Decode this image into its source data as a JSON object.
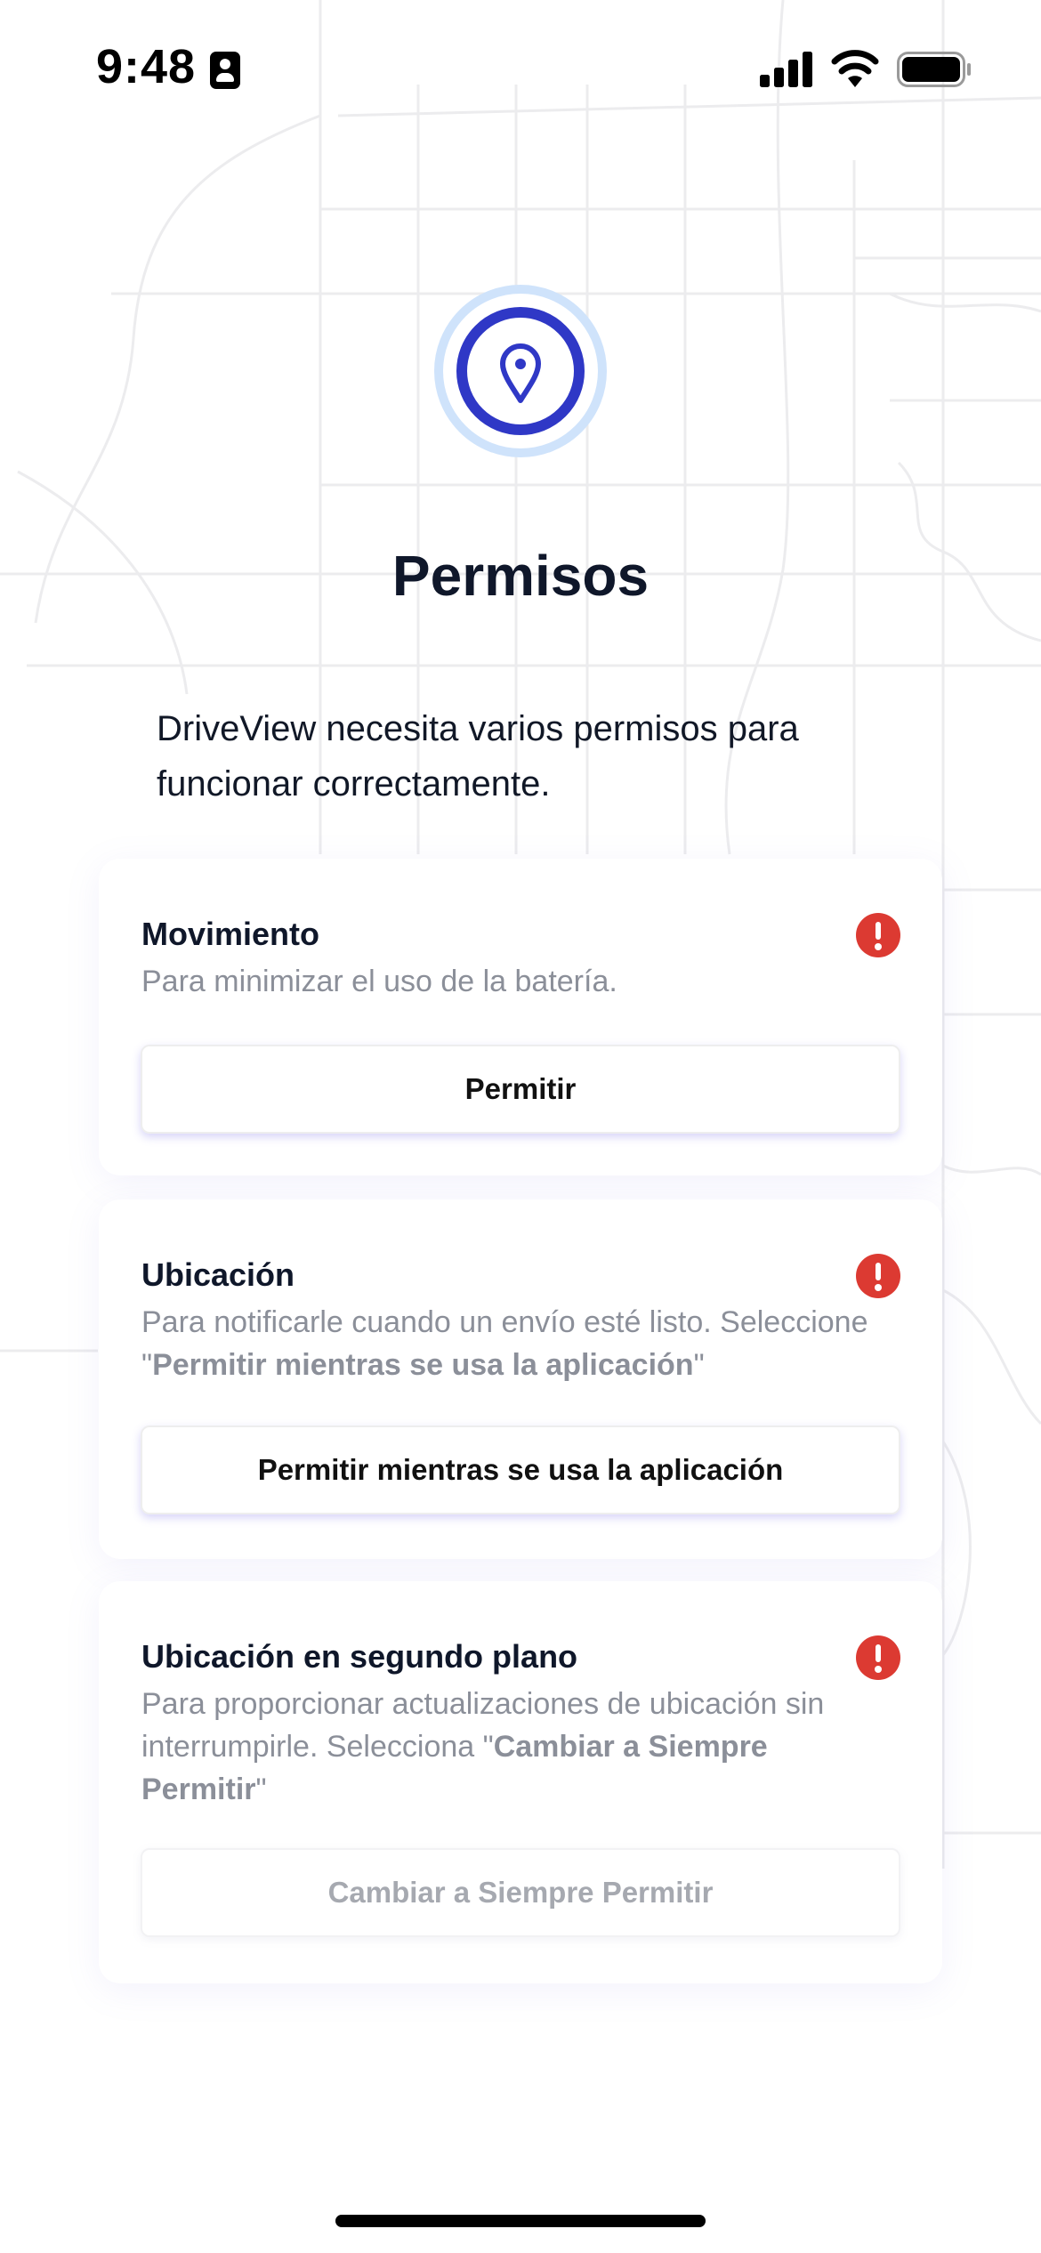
{
  "status_bar": {
    "time": "9:48",
    "icons": [
      "id-card-icon",
      "signal-icon",
      "wifi-icon",
      "battery-icon"
    ]
  },
  "hero": {
    "icon": "location-pin-icon",
    "accent_color": "#2f38c6",
    "ring_color": "#cfe3fb"
  },
  "page": {
    "title": "Permisos",
    "intro": "DriveView necesita varios permisos para funcionar correctamente."
  },
  "permissions": [
    {
      "title": "Movimiento",
      "description": "Para minimizar el uso de la batería.",
      "status_icon": "alert-icon",
      "button_label": "Permitir",
      "enabled": true
    },
    {
      "title": "Ubicación",
      "description_before": "Para notificarle cuando un envío esté listo. Seleccione \"",
      "description_bold": "Permitir mientras se usa la aplicación",
      "description_after": "\"",
      "status_icon": "alert-icon",
      "button_label": "Permitir mientras se usa la aplicación",
      "enabled": true
    },
    {
      "title": "Ubicación en segundo plano",
      "description_before": "Para proporcionar actualizaciones de ubicación sin interrumpirle. Selecciona \"",
      "description_bold": "Cambiar a Siempre Permitir",
      "description_after": "\"",
      "status_icon": "alert-icon",
      "button_label": "Cambiar a Siempre Permitir",
      "enabled": false
    }
  ],
  "colors": {
    "alert": "#dc3a32",
    "text_primary": "#0f172a",
    "text_secondary": "#8b8f99",
    "button_shadow": "#6e64e6"
  }
}
